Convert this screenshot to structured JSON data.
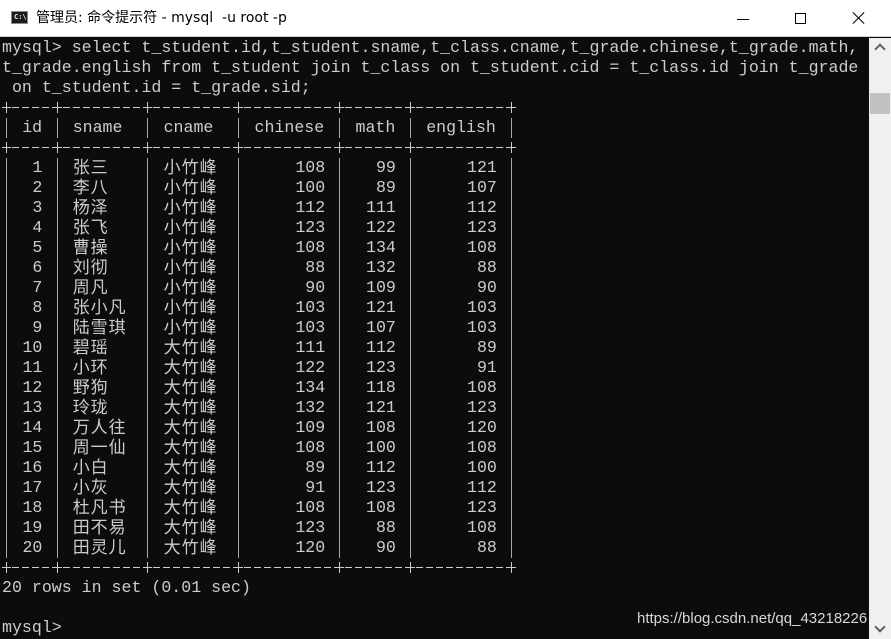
{
  "window": {
    "title": "管理员: 命令提示符 - mysql  -u root -p",
    "icon": "cmd-icon",
    "icon_text": "C:\\.",
    "buttons": {
      "minimize": "minimize-icon",
      "maximize": "maximize-icon",
      "close": "close-icon"
    }
  },
  "terminal": {
    "command_lines": [
      "mysql> select t_student.id,t_student.sname,t_class.cname,t_grade.chinese,t_grade.math,",
      "t_grade.english from t_student join t_class on t_student.cid = t_class.id join t_grade",
      " on t_student.id = t_grade.sid;"
    ],
    "table": {
      "columns": [
        "id",
        "sname",
        "cname",
        "chinese",
        "math",
        "english"
      ],
      "rows": [
        [
          "1",
          "张三",
          "小竹峰",
          "108",
          "99",
          "121"
        ],
        [
          "2",
          "李八",
          "小竹峰",
          "100",
          "89",
          "107"
        ],
        [
          "3",
          "杨泽",
          "小竹峰",
          "112",
          "111",
          "112"
        ],
        [
          "4",
          "张飞",
          "小竹峰",
          "123",
          "122",
          "123"
        ],
        [
          "5",
          "曹操",
          "小竹峰",
          "108",
          "134",
          "108"
        ],
        [
          "6",
          "刘彻",
          "小竹峰",
          "88",
          "132",
          "88"
        ],
        [
          "7",
          "周凡",
          "小竹峰",
          "90",
          "109",
          "90"
        ],
        [
          "8",
          "张小凡",
          "小竹峰",
          "103",
          "121",
          "103"
        ],
        [
          "9",
          "陆雪琪",
          "小竹峰",
          "103",
          "107",
          "103"
        ],
        [
          "10",
          "碧瑶",
          "大竹峰",
          "111",
          "112",
          "89"
        ],
        [
          "11",
          "小环",
          "大竹峰",
          "122",
          "123",
          "91"
        ],
        [
          "12",
          "野狗",
          "大竹峰",
          "134",
          "118",
          "108"
        ],
        [
          "13",
          "玲珑",
          "大竹峰",
          "132",
          "121",
          "123"
        ],
        [
          "14",
          "万人往",
          "大竹峰",
          "109",
          "108",
          "120"
        ],
        [
          "15",
          "周一仙",
          "大竹峰",
          "108",
          "100",
          "108"
        ],
        [
          "16",
          "小白",
          "大竹峰",
          "89",
          "112",
          "100"
        ],
        [
          "17",
          "小灰",
          "大竹峰",
          "91",
          "123",
          "112"
        ],
        [
          "18",
          "杜凡书",
          "大竹峰",
          "108",
          "108",
          "123"
        ],
        [
          "19",
          "田不易",
          "大竹峰",
          "123",
          "88",
          "108"
        ],
        [
          "20",
          "田灵儿",
          "大竹峰",
          "120",
          "90",
          "88"
        ]
      ]
    },
    "result_summary": "20 rows in set (0.01 sec)",
    "prompt": "mysql>"
  },
  "watermark": "https://blog.csdn.net/qq_43218226",
  "colors": {
    "background": "#0c0c0c",
    "text": "#cccccc",
    "titlebar": "#ffffff",
    "scrollbar": "#f0f0f0",
    "scroll_thumb": "#c2c2c2"
  }
}
